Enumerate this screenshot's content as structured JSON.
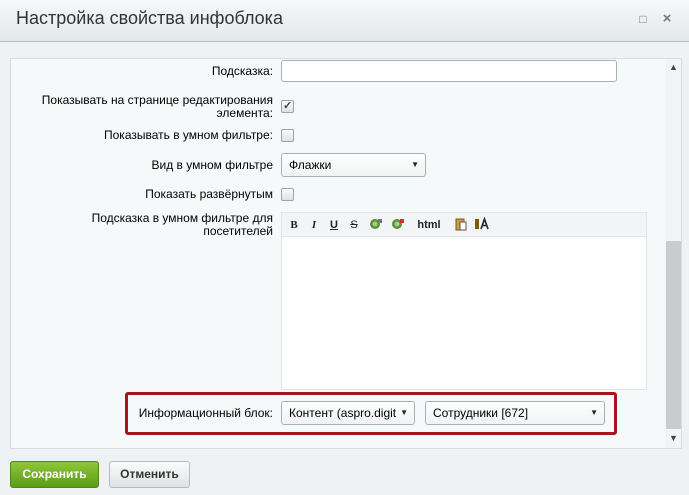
{
  "window": {
    "title": "Настройка свойства инфоблока",
    "maximize_glyph": "□",
    "close_glyph": "×"
  },
  "form": {
    "hint": {
      "label": "Подсказка:",
      "value": ""
    },
    "show_on_edit_page": {
      "label_line1": "Показывать на странице редактирования",
      "label_line2": "элемента:",
      "checked": true
    },
    "show_in_smart_filter": {
      "label": "Показывать в умном фильтре:",
      "checked": false
    },
    "smart_filter_view": {
      "label": "Вид в умном фильтре",
      "selected": "Флажки"
    },
    "show_expanded": {
      "label": "Показать развёрнутым",
      "checked": false
    },
    "smart_filter_hint": {
      "label_line1": "Подсказка в умном фильтре для",
      "label_line2": "посетителей",
      "toolbar": {
        "bold": "B",
        "italic": "I",
        "underline": "U",
        "strike": "S",
        "html": "html"
      },
      "value": ""
    },
    "info_block": {
      "label": "Информационный блок:",
      "type_selected": "Контент (aspro.digit",
      "iblock_selected": "Сотрудники [672]"
    }
  },
  "buttons": {
    "save": "Сохранить",
    "cancel": "Отменить"
  },
  "colors": {
    "highlight_border": "#a5151b",
    "save_button": "#6aa921"
  }
}
